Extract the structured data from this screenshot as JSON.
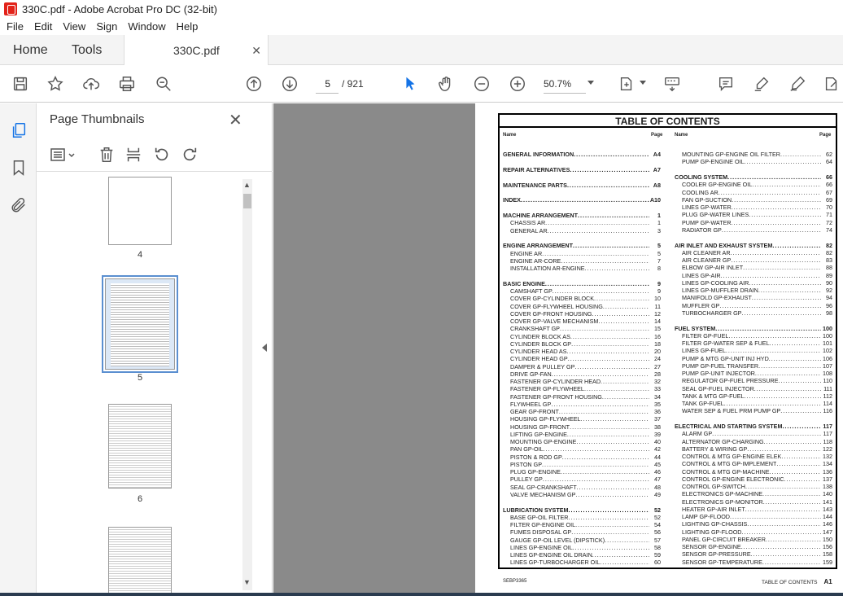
{
  "window": {
    "title": "330C.pdf - Adobe Acrobat Pro DC (32-bit)"
  },
  "menu": [
    "File",
    "Edit",
    "View",
    "Sign",
    "Window",
    "Help"
  ],
  "tabs": {
    "home": "Home",
    "tools": "Tools",
    "doc": "330C.pdf"
  },
  "toolbar": {
    "page_current": "5",
    "page_total": "/ 921",
    "zoom": "50.7%"
  },
  "panel": {
    "title": "Page Thumbnails",
    "thumb_labels": [
      "4",
      "5",
      "6"
    ]
  },
  "toc": {
    "title": "TABLE OF CONTENTS",
    "col_name": "Name",
    "col_page": "Page",
    "footer_left": "SEBP3365",
    "footer_right": "TABLE OF CONTENTS",
    "footer_page": "A1",
    "left": [
      {
        "t": "GENERAL INFORMATION",
        "p": "A4",
        "b": true,
        "gap": true
      },
      {
        "t": "REPAIR ALTERNATIVES",
        "p": "A7",
        "b": true,
        "gap": true
      },
      {
        "t": "MAINTENANCE PARTS",
        "p": "A8",
        "b": true,
        "gap": true
      },
      {
        "t": "INDEX",
        "p": "A10",
        "b": true,
        "gap": true
      },
      {
        "t": "MACHINE ARRANGEMENT",
        "p": "1",
        "b": true
      },
      {
        "t": "CHASSIS AR",
        "p": "1"
      },
      {
        "t": "GENERAL AR",
        "p": "3",
        "gap": true
      },
      {
        "t": "ENGINE ARRANGEMENT",
        "p": "5",
        "b": true
      },
      {
        "t": "ENGINE AR",
        "p": "5"
      },
      {
        "t": "ENGINE AR-CORE",
        "p": "7"
      },
      {
        "t": "INSTALLATION AR-ENGINE",
        "p": "8",
        "gap": true
      },
      {
        "t": "BASIC ENGINE",
        "p": "9",
        "b": true
      },
      {
        "t": "CAMSHAFT GP",
        "p": "9"
      },
      {
        "t": "COVER GP-CYLINDER BLOCK",
        "p": "10"
      },
      {
        "t": "COVER GP-FLYWHEEL HOUSING",
        "p": "11"
      },
      {
        "t": "COVER GP-FRONT HOUSING",
        "p": "12"
      },
      {
        "t": "COVER GP-VALVE MECHANISM",
        "p": "14"
      },
      {
        "t": "CRANKSHAFT GP",
        "p": "15"
      },
      {
        "t": "CYLINDER BLOCK AS",
        "p": "16"
      },
      {
        "t": "CYLINDER BLOCK GP",
        "p": "18"
      },
      {
        "t": "CYLINDER HEAD AS",
        "p": "20"
      },
      {
        "t": "CYLINDER HEAD GP",
        "p": "24"
      },
      {
        "t": "DAMPER & PULLEY GP",
        "p": "27"
      },
      {
        "t": "DRIVE GP-FAN",
        "p": "28"
      },
      {
        "t": "FASTENER GP-CYLINDER HEAD",
        "p": "32"
      },
      {
        "t": "FASTENER GP-FLYWHEEL",
        "p": "33"
      },
      {
        "t": "FASTENER GP-FRONT HOUSING",
        "p": "34"
      },
      {
        "t": "FLYWHEEL GP",
        "p": "35"
      },
      {
        "t": "GEAR GP-FRONT",
        "p": "36"
      },
      {
        "t": "HOUSING GP-FLYWHEEL",
        "p": "37"
      },
      {
        "t": "HOUSING GP-FRONT",
        "p": "38"
      },
      {
        "t": "LIFTING GP-ENGINE",
        "p": "39"
      },
      {
        "t": "MOUNTING GP-ENGINE",
        "p": "40"
      },
      {
        "t": "PAN GP-OIL",
        "p": "42"
      },
      {
        "t": "PISTON & ROD GP",
        "p": "44"
      },
      {
        "t": "PISTON GP",
        "p": "45"
      },
      {
        "t": "PLUG GP-ENGINE",
        "p": "46"
      },
      {
        "t": "PULLEY GP",
        "p": "47"
      },
      {
        "t": "SEAL GP-CRANKSHAFT",
        "p": "48"
      },
      {
        "t": "VALVE MECHANISM GP",
        "p": "49",
        "gap": true
      },
      {
        "t": "LUBRICATION SYSTEM",
        "p": "52",
        "b": true
      },
      {
        "t": "BASE GP-OIL FILTER",
        "p": "52"
      },
      {
        "t": "FILTER GP-ENGINE OIL",
        "p": "54"
      },
      {
        "t": "FUMES DISPOSAL GP",
        "p": "56"
      },
      {
        "t": "GAUGE GP-OIL LEVEL (DIPSTICK)",
        "p": "57"
      },
      {
        "t": "LINES GP-ENGINE OIL",
        "p": "58"
      },
      {
        "t": "LINES GP-ENGINE OIL DRAIN",
        "p": "59"
      },
      {
        "t": "LINES GP-TURBOCHARGER OIL",
        "p": "60"
      }
    ],
    "right": [
      {
        "t": "MOUNTING GP-ENGINE OIL FILTER",
        "p": "62"
      },
      {
        "t": "PUMP GP-ENGINE OIL",
        "p": "64",
        "gap": true
      },
      {
        "t": "COOLING SYSTEM",
        "p": "66",
        "b": true
      },
      {
        "t": "COOLER GP-ENGINE OIL",
        "p": "66"
      },
      {
        "t": "COOLING AR",
        "p": "67"
      },
      {
        "t": "FAN GP-SUCTION",
        "p": "69"
      },
      {
        "t": "LINES GP-WATER",
        "p": "70"
      },
      {
        "t": "PLUG GP-WATER LINES",
        "p": "71"
      },
      {
        "t": "PUMP GP-WATER",
        "p": "72"
      },
      {
        "t": "RADIATOR GP",
        "p": "74",
        "gap": true
      },
      {
        "t": "AIR INLET AND EXHAUST SYSTEM",
        "p": "82",
        "b": true
      },
      {
        "t": "AIR CLEANER AR",
        "p": "82"
      },
      {
        "t": "AIR CLEANER GP",
        "p": "83"
      },
      {
        "t": "ELBOW GP-AIR INLET",
        "p": "88"
      },
      {
        "t": "LINES GP-AIR",
        "p": "89"
      },
      {
        "t": "LINES GP-COOLING AIR",
        "p": "90"
      },
      {
        "t": "LINES GP-MUFFLER DRAIN",
        "p": "92"
      },
      {
        "t": "MANIFOLD GP-EXHAUST",
        "p": "94"
      },
      {
        "t": "MUFFLER GP",
        "p": "96"
      },
      {
        "t": "TURBOCHARGER GP",
        "p": "98",
        "gap": true
      },
      {
        "t": "FUEL SYSTEM",
        "p": "100",
        "b": true
      },
      {
        "t": "FILTER GP-FUEL",
        "p": "100"
      },
      {
        "t": "FILTER GP-WATER SEP & FUEL",
        "p": "101"
      },
      {
        "t": "LINES GP-FUEL",
        "p": "102"
      },
      {
        "t": "PUMP & MTG GP-UNIT INJ HYD",
        "p": "106"
      },
      {
        "t": "PUMP GP-FUEL TRANSFER",
        "p": "107"
      },
      {
        "t": "PUMP GP-UNIT INJECTOR",
        "p": "108"
      },
      {
        "t": "REGULATOR GP-FUEL PRESSURE",
        "p": "110"
      },
      {
        "t": "SEAL GP-FUEL INJECTOR",
        "p": "111"
      },
      {
        "t": "TANK & MTG GP-FUEL",
        "p": "112"
      },
      {
        "t": "TANK GP-FUEL",
        "p": "114"
      },
      {
        "t": "WATER SEP & FUEL PRM PUMP GP",
        "p": "116",
        "gap": true
      },
      {
        "t": "ELECTRICAL AND STARTING SYSTEM",
        "p": "117",
        "b": true
      },
      {
        "t": "ALARM GP",
        "p": "117"
      },
      {
        "t": "ALTERNATOR GP-CHARGING",
        "p": "118"
      },
      {
        "t": "BATTERY & WIRING GP",
        "p": "122"
      },
      {
        "t": "CONTROL & MTG GP-ENGINE ELEK",
        "p": "132"
      },
      {
        "t": "CONTROL & MTG GP-IMPLEMENT",
        "p": "134"
      },
      {
        "t": "CONTROL & MTG GP-MACHINE",
        "p": "136"
      },
      {
        "t": "CONTROL GP-ENGINE ELECTRONIC",
        "p": "137"
      },
      {
        "t": "CONTROL GP-SWITCH",
        "p": "138"
      },
      {
        "t": "ELECTRONICS GP-MACHINE",
        "p": "140"
      },
      {
        "t": "ELECTRONICS GP-MONITOR",
        "p": "141"
      },
      {
        "t": "HEATER GP-AIR INLET",
        "p": "143"
      },
      {
        "t": "LAMP GP-FLOOD",
        "p": "144"
      },
      {
        "t": "LIGHTING GP-CHASSIS",
        "p": "146"
      },
      {
        "t": "LIGHTING GP-FLOOD",
        "p": "147"
      },
      {
        "t": "PANEL GP-CIRCUIT BREAKER",
        "p": "150"
      },
      {
        "t": "SENSOR GP-ENGINE",
        "p": "156"
      },
      {
        "t": "SENSOR GP-PRESSURE",
        "p": "158"
      },
      {
        "t": "SENSOR GP-TEMPERATURE",
        "p": "159"
      }
    ]
  }
}
